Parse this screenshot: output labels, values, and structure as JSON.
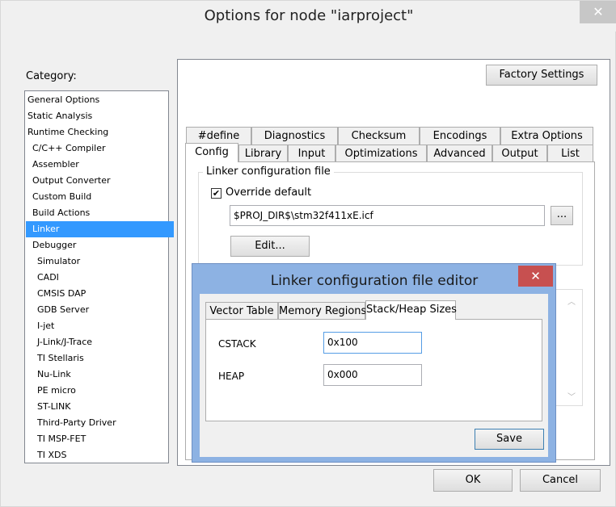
{
  "window": {
    "title": "Options for node \"iarproject\"",
    "close_glyph": "✕"
  },
  "category": {
    "label": "Category:",
    "items": [
      "General Options",
      "Static Analysis",
      "Runtime Checking",
      "C/C++ Compiler",
      "Assembler",
      "Output Converter",
      "Custom Build",
      "Build Actions",
      "Linker",
      "Debugger",
      "Simulator",
      "CADI",
      "CMSIS DAP",
      "GDB Server",
      "I-jet",
      "J-Link/J-Trace",
      "TI Stellaris",
      "Nu-Link",
      "PE micro",
      "ST-LINK",
      "Third-Party Driver",
      "TI MSP-FET",
      "TI XDS"
    ],
    "selected": "Linker"
  },
  "panel": {
    "factory_settings": "Factory Settings",
    "tabs_row1": [
      "#define",
      "Diagnostics",
      "Checksum",
      "Encodings",
      "Extra Options"
    ],
    "tabs_row2": [
      "Config",
      "Library",
      "Input",
      "Optimizations",
      "Advanced",
      "Output",
      "List"
    ],
    "active_tab": "Config",
    "group_label": "Linker configuration file",
    "override_label": "Override default",
    "override_checked": true,
    "path_value": "$PROJ_DIR$\\stm32f411xE.icf",
    "browse_label": "...",
    "edit_label": "Edit..."
  },
  "dialog": {
    "title": "Linker configuration file editor",
    "close_glyph": "✕",
    "tabs": [
      "Vector Table",
      "Memory Regions",
      "Stack/Heap Sizes"
    ],
    "active_tab": "Stack/Heap Sizes",
    "cstack_label": "CSTACK",
    "cstack_value": "0x100",
    "heap_label": "HEAP",
    "heap_value": "0x000",
    "save_label": "Save"
  },
  "footer": {
    "ok_label": "OK",
    "cancel_label": "Cancel"
  },
  "colors": {
    "selection": "#3399ff",
    "dialog_frame": "#8db2e3",
    "dialog_close": "#c75050",
    "window_close": "#c7c7c7"
  }
}
